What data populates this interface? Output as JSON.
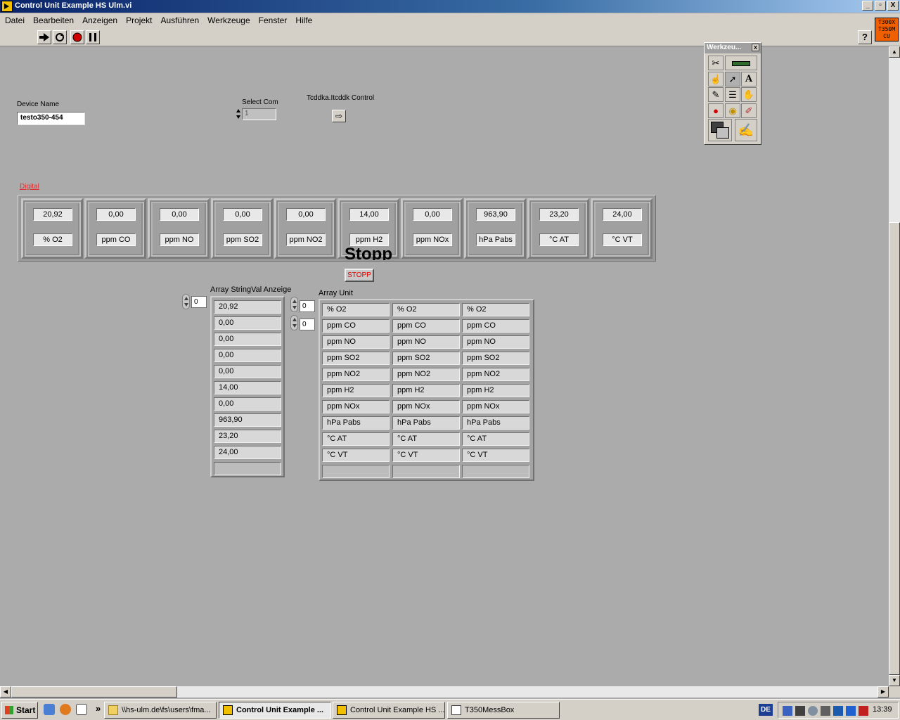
{
  "window": {
    "title": "Control Unit Example HS Ulm.vi",
    "buttons": [
      "_",
      "▫",
      "X"
    ]
  },
  "menu": [
    {
      "label": "Datei"
    },
    {
      "label": "Bearbeiten"
    },
    {
      "label": "Anzeigen"
    },
    {
      "label": "Projekt"
    },
    {
      "label": "Ausführen"
    },
    {
      "label": "Werkzeuge"
    },
    {
      "label": "Fenster"
    },
    {
      "label": "Hilfe"
    }
  ],
  "toolbar": {
    "help": "?",
    "vi_icon_lines": [
      "T300X",
      "T350M",
      "CU"
    ]
  },
  "controls": {
    "device_name_label": "Device Name",
    "device_name_value": "testo350-454",
    "select_com_label": "Select Com",
    "select_com_value": "1",
    "refnum_label": "Tcddka.Itcddk Control",
    "refnum_glyph": "⇨"
  },
  "digital": {
    "label": "Digital",
    "cells": [
      {
        "value": "20,92",
        "unit": "% O2"
      },
      {
        "value": "0,00",
        "unit": "ppm CO"
      },
      {
        "value": "0,00",
        "unit": "ppm NO"
      },
      {
        "value": "0,00",
        "unit": "ppm SO2"
      },
      {
        "value": "0,00",
        "unit": "ppm NO2"
      },
      {
        "value": "14,00",
        "unit": "ppm H2"
      },
      {
        "value": "0,00",
        "unit": "ppm NOx"
      },
      {
        "value": "963,90",
        "unit": "hPa Pabs"
      },
      {
        "value": "23,20",
        "unit": "°C AT"
      },
      {
        "value": "24,00",
        "unit": "°C VT"
      }
    ]
  },
  "stopp": {
    "title": "Stopp",
    "button": "STOPP"
  },
  "array_string": {
    "label": "Array StringVal Anzeige",
    "index": "0",
    "values": [
      "20,92",
      "0,00",
      "0,00",
      "0,00",
      "0,00",
      "14,00",
      "0,00",
      "963,90",
      "23,20",
      "24,00",
      ""
    ]
  },
  "array_unit": {
    "label": "Array Unit",
    "index_row": "0",
    "index_col": "0",
    "rows": [
      [
        "% O2",
        "% O2",
        "% O2"
      ],
      [
        "ppm CO",
        "ppm CO",
        "ppm CO"
      ],
      [
        "ppm NO",
        "ppm NO",
        "ppm NO"
      ],
      [
        "ppm SO2",
        "ppm SO2",
        "ppm SO2"
      ],
      [
        "ppm NO2",
        "ppm NO2",
        "ppm NO2"
      ],
      [
        "ppm H2",
        "ppm H2",
        "ppm H2"
      ],
      [
        "ppm NOx",
        "ppm NOx",
        "ppm NOx"
      ],
      [
        "hPa Pabs",
        "hPa Pabs",
        "hPa Pabs"
      ],
      [
        "°C AT",
        "°C AT",
        "°C AT"
      ],
      [
        "°C VT",
        "°C VT",
        "°C VT"
      ],
      [
        "",
        "",
        ""
      ]
    ]
  },
  "palette": {
    "title": "Werkzeu...",
    "close": "x"
  },
  "taskbar": {
    "start": "Start",
    "more": "»",
    "tasks": [
      {
        "label": "\\\\hs-ulm.de\\fs\\users\\fma...",
        "active": false
      },
      {
        "label": "Control Unit Example ...",
        "active": true
      },
      {
        "label": "Control Unit Example HS ...",
        "active": false
      },
      {
        "label": "T350MessBox",
        "active": false
      }
    ],
    "language": "DE",
    "clock": "13:39"
  }
}
